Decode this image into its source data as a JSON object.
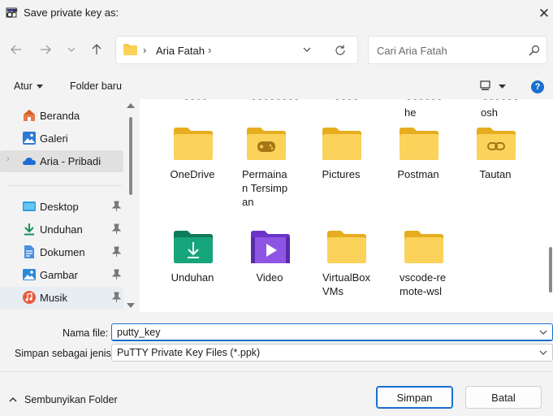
{
  "window": {
    "title": "Save private key as:",
    "close_glyph": "✕",
    "icon": "putty-key-icon"
  },
  "navigation": {
    "back_icon": "arrow-left-icon",
    "forward_icon": "arrow-right-icon",
    "recent_icon": "chevron-down-icon",
    "up_icon": "arrow-up-icon"
  },
  "address_bar": {
    "chevron": "›",
    "location": "Aria Fatah"
  },
  "search": {
    "placeholder": "Cari Aria Fatah"
  },
  "command_bar": {
    "organize_label": "Atur",
    "new_folder_label": "Folder baru",
    "help_label": "?"
  },
  "sidebar": {
    "items": [
      {
        "label": "Beranda",
        "icon": "home-icon"
      },
      {
        "label": "Galeri",
        "icon": "gallery-icon"
      },
      {
        "label": "Aria - Pribadi",
        "icon": "onedrive-cloud-icon",
        "selected": true
      },
      {
        "label": "Desktop",
        "icon": "desktop-icon",
        "pinned": true
      },
      {
        "label": "Unduhan",
        "icon": "download-icon",
        "pinned": true
      },
      {
        "label": "Dokumen",
        "icon": "document-icon",
        "pinned": true
      },
      {
        "label": "Gambar",
        "icon": "pictures-icon",
        "pinned": true
      },
      {
        "label": "Musik",
        "icon": "music-icon",
        "pinned": true
      }
    ],
    "expand_chevron": "›"
  },
  "content": {
    "cut_row": [
      {
        "line1": "~~~~",
        "line2": ""
      },
      {
        "line1": "~~~~~~~~",
        "line2": ""
      },
      {
        "line1": "~~~~",
        "line2": ""
      },
      {
        "line1": "~~~~~~",
        "line2": "he"
      },
      {
        "line1": "~~~~~~",
        "line2": "osh"
      }
    ],
    "folders": [
      {
        "label": "OneDrive",
        "icon": "folder-icon"
      },
      {
        "label": "Permainan Tersimpan",
        "icon": "saved-games-folder-icon"
      },
      {
        "label": "Pictures",
        "icon": "folder-icon"
      },
      {
        "label": "Postman",
        "icon": "folder-icon"
      },
      {
        "label": "Tautan",
        "icon": "links-folder-icon"
      },
      {
        "label": "Unduhan",
        "icon": "downloads-folder-icon"
      },
      {
        "label": "Video",
        "icon": "videos-folder-icon"
      },
      {
        "label": "VirtualBox VMs",
        "icon": "folder-icon"
      },
      {
        "label": "vscode-remote-wsl",
        "icon": "folder-icon"
      }
    ]
  },
  "form": {
    "filename_label": "Nama file:",
    "filename_value": "putty_key",
    "filetype_label": "Simpan sebagai jenis:",
    "filetype_value": "PuTTY Private Key Files (*.ppk)"
  },
  "footer": {
    "hide_folders_label": "Sembunyikan Folder",
    "save_label": "Simpan",
    "cancel_label": "Batal"
  },
  "colors": {
    "accent": "#1a6fd0",
    "folder": "#f8c94a",
    "folder_dark": "#e6ad1f"
  }
}
